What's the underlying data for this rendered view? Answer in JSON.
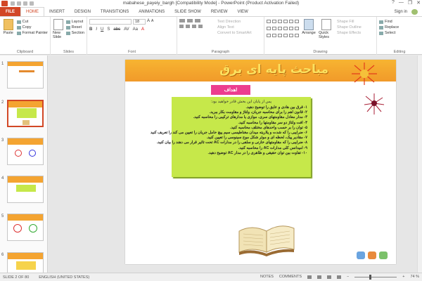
{
  "window": {
    "title": "mabahese_payeiy_bargh [Compatibility Mode] - PowerPoint (Product Activation Failed)",
    "controls": [
      "?",
      "—",
      "❐",
      "✕"
    ],
    "sign_in": "Sign in"
  },
  "tabs": [
    {
      "label": "FILE",
      "kind": "file"
    },
    {
      "label": "HOME",
      "kind": "active"
    },
    {
      "label": "INSERT",
      "kind": ""
    },
    {
      "label": "DESIGN",
      "kind": ""
    },
    {
      "label": "TRANSITIONS",
      "kind": ""
    },
    {
      "label": "ANIMATIONS",
      "kind": ""
    },
    {
      "label": "SLIDE SHOW",
      "kind": ""
    },
    {
      "label": "REVIEW",
      "kind": ""
    },
    {
      "label": "VIEW",
      "kind": ""
    }
  ],
  "ribbon": {
    "clipboard": {
      "paste": "Paste",
      "cut": "Cut",
      "copy": "Copy",
      "format_painter": "Format Painter",
      "label": "Clipboard"
    },
    "slides": {
      "new_slide": "New Slide",
      "layout": "Layout",
      "reset": "Reset",
      "section": "Section",
      "label": "Slides"
    },
    "font": {
      "size": "18",
      "format_buttons": [
        "B",
        "I",
        "U",
        "S",
        "abc",
        "AV",
        "Aa",
        "A"
      ],
      "label": "Font"
    },
    "paragraph": {
      "text_direction": "Text Direction",
      "align_text": "Align Text",
      "convert_smartart": "Convert to SmartArt",
      "label": "Paragraph"
    },
    "drawing": {
      "arrange": "Arrange",
      "quick_styles": "Quick Styles",
      "shape_fill": "Shape Fill",
      "shape_outline": "Shape Outline",
      "shape_effects": "Shape Effects",
      "label": "Drawing"
    },
    "editing": {
      "find": "Find",
      "replace": "Replace",
      "select": "Select",
      "label": "Editing"
    }
  },
  "thumbnails": [
    {
      "num": "1",
      "selected": false
    },
    {
      "num": "2",
      "selected": true
    },
    {
      "num": "3",
      "selected": false
    },
    {
      "num": "4",
      "selected": false
    },
    {
      "num": "5",
      "selected": false
    },
    {
      "num": "6",
      "selected": false
    }
  ],
  "slide": {
    "title": "مباحث پایه ای برق",
    "badge": "اهداف",
    "lead": "پس از پایان این بخش قادر خواهید بود:",
    "objectives": [
      "۱- قرق بین هادی و عایق را توضیح دهید.",
      "۲- قانون اهم را برای محاسبه جریان، ولتاژ و مقاومت بکار ببرید.",
      "۳- مدار معادل مقاومتهای سری، موازی یا مدارهای ترکیبی را محاسبه کنید.",
      "۴- افت ولتاژ دو سر مقاومتها را محاسبه کنید.",
      "۵- توان را بر حسب واحدهای مختلف محاسبه کنید.",
      "۶- ضرایبی را که شدت و پلاریته میدان مغناطیسی سیم پیچ حامل جریان را تعیین می کند را تعریف کنید",
      "۷- مقادیر پیک، لحظه ای و موثر شکل موج سینوسی را تعیین کنید.",
      "۸- ضرایبی را که مقاومتهای خازنی و سلفی را در مدارات AC تحت تاثیر قرار می دهند را بیان کنید.",
      "۹- امپدانس کلی مدارات AC را محاسبه کنید.",
      "۱۰- تفاوت بین توان حقیقی و ظاهری را در مدار AC توضیح دهید."
    ]
  },
  "status": {
    "slide_info": "SLIDE 2 OF 80",
    "language": "ENGLISH (UNITED STATES)",
    "notes": "NOTES",
    "comments": "COMMENTS",
    "zoom": "74 %",
    "zoom_level": 0.74
  },
  "colors": {
    "accent": "#d24726",
    "slide_header": "#f4a431",
    "content_box": "#c6e84a",
    "badge": "#ec3d8f"
  }
}
